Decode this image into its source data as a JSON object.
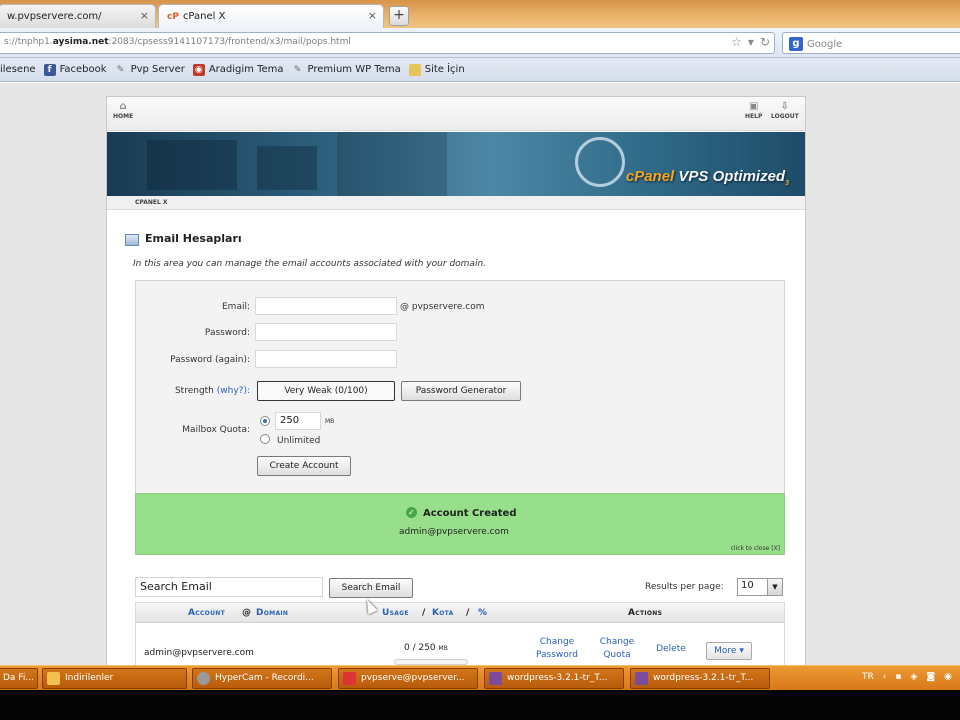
{
  "browser": {
    "tabs": [
      {
        "label": "w.pvpservere.com/",
        "active": false
      },
      {
        "label": "cPanel X",
        "active": true,
        "favicon": "cP"
      }
    ],
    "new_tab_label": "+",
    "close_glyph": "×",
    "url": {
      "prefix": "s://tnphp1.",
      "host": "aysima.net",
      "rest": ":2083/cpsess9141107173/frontend/x3/mail/pops.html"
    },
    "search_placeholder": "Google",
    "bookmarks": [
      {
        "label": "ilesene",
        "icon": "none"
      },
      {
        "label": "Facebook",
        "icon": "facebook-icon",
        "color": "#3b5998"
      },
      {
        "label": "Pvp Server",
        "icon": "pin-icon",
        "color": "#6c6c6c"
      },
      {
        "label": "Aradigim Tema",
        "icon": "camera-icon",
        "color": "#c0392b"
      },
      {
        "label": "Premium WP Tema",
        "icon": "pin-icon",
        "color": "#6c6c6c"
      },
      {
        "label": "Site İçin",
        "icon": "folder-icon",
        "color": "#e8c35a"
      }
    ]
  },
  "cpanel": {
    "nav": {
      "home": "HOME",
      "help": "HELP",
      "logout": "LOGOUT"
    },
    "brand": {
      "cp": "cPanel",
      "rest": " VPS Optimized",
      "sub": "3"
    },
    "subnav": "CPANEL X",
    "title": "Email Hesapları",
    "description": "In this area you can manage the email accounts associated with your domain.",
    "form": {
      "email_label": "Email:",
      "email_value": "",
      "domain": "@ pvpservere.com",
      "password_label": "Password:",
      "password_again_label": "Password (again):",
      "strength_label": "Strength",
      "strength_link": "(why?):",
      "strength_value": "Very Weak (0/100)",
      "generator_button": "Password Generator",
      "quota_label": "Mailbox Quota:",
      "quota_value": "250",
      "quota_unit": "MB",
      "unlimited_label": "Unlimited",
      "create_button": "Create Account"
    },
    "success": {
      "title": "Account Created",
      "email": "admin@pvpservere.com",
      "close": "click to close [X]"
    },
    "search": {
      "value": "Search Email",
      "button": "Search Email"
    },
    "results_per_page": {
      "label": "Results per page:",
      "value": "10"
    },
    "table": {
      "headers": {
        "account": "Account",
        "at": "@",
        "domain": "Domain",
        "usage": "Usage",
        "slash1": "/",
        "quota": "Kota",
        "slash2": "/",
        "percent": "%",
        "actions": "Actions"
      },
      "rows": [
        {
          "account": "admin@pvpservere.com",
          "usage": "0 / 250",
          "usage_unit": "MB",
          "usage_fraction": 0.0,
          "change_password": [
            "Change",
            "Password"
          ],
          "change_quota": [
            "Change",
            "Quota"
          ],
          "delete": "Delete",
          "more": "More ▾"
        }
      ]
    }
  },
  "taskbar": {
    "items": [
      {
        "label": "Da Fi..."
      },
      {
        "label": "Indirilenler"
      },
      {
        "label": "HyperCam - Recordi..."
      },
      {
        "label": "pvpserve@pvpserver..."
      },
      {
        "label": "wordpress-3.2.1-tr_T..."
      },
      {
        "label": "wordpress-3.2.1-tr_T..."
      }
    ],
    "tray": [
      "TR",
      "‹",
      "▪",
      "◈",
      "◙",
      "◉"
    ]
  }
}
